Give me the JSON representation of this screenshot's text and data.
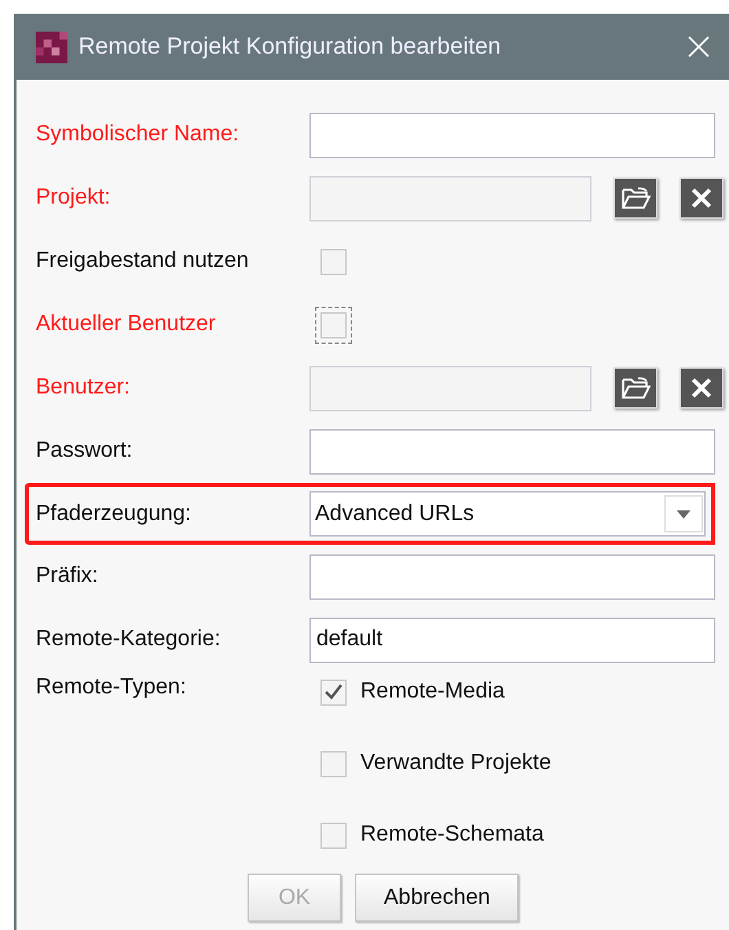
{
  "window": {
    "title": "Remote Projekt Konfiguration bearbeiten"
  },
  "rows": [
    {
      "kind": "text",
      "label": "Symbolischer Name:",
      "required": true
    },
    {
      "kind": "picker",
      "label": "Projekt:",
      "required": true
    },
    {
      "kind": "checkbox",
      "label": "Freigabestand nutzen",
      "required": false,
      "checked": false,
      "focused": false
    },
    {
      "kind": "checkbox",
      "label": "Aktueller Benutzer",
      "required": true,
      "checked": false,
      "focused": true
    },
    {
      "kind": "picker",
      "label": "Benutzer:",
      "required": true
    },
    {
      "kind": "text",
      "label": "Passwort:",
      "required": false
    },
    {
      "kind": "select",
      "label": "Pfaderzeugung:",
      "required": false,
      "value": "Advanced URLs",
      "highlighted": true
    },
    {
      "kind": "text",
      "label": "Präfix:",
      "required": false
    },
    {
      "kind": "text",
      "label": "Remote-Kategorie:",
      "required": false,
      "value": "default"
    },
    {
      "kind": "options",
      "label": "Remote-Typen:",
      "required": false,
      "options": [
        {
          "label": "Remote-Media",
          "checked": true
        },
        {
          "label": "Verwandte Projekte",
          "checked": false
        },
        {
          "label": "Remote-Schemata",
          "checked": false
        }
      ]
    }
  ],
  "buttons": [
    {
      "label": "OK",
      "disabled": true
    },
    {
      "label": "Abbrechen",
      "disabled": false
    }
  ]
}
